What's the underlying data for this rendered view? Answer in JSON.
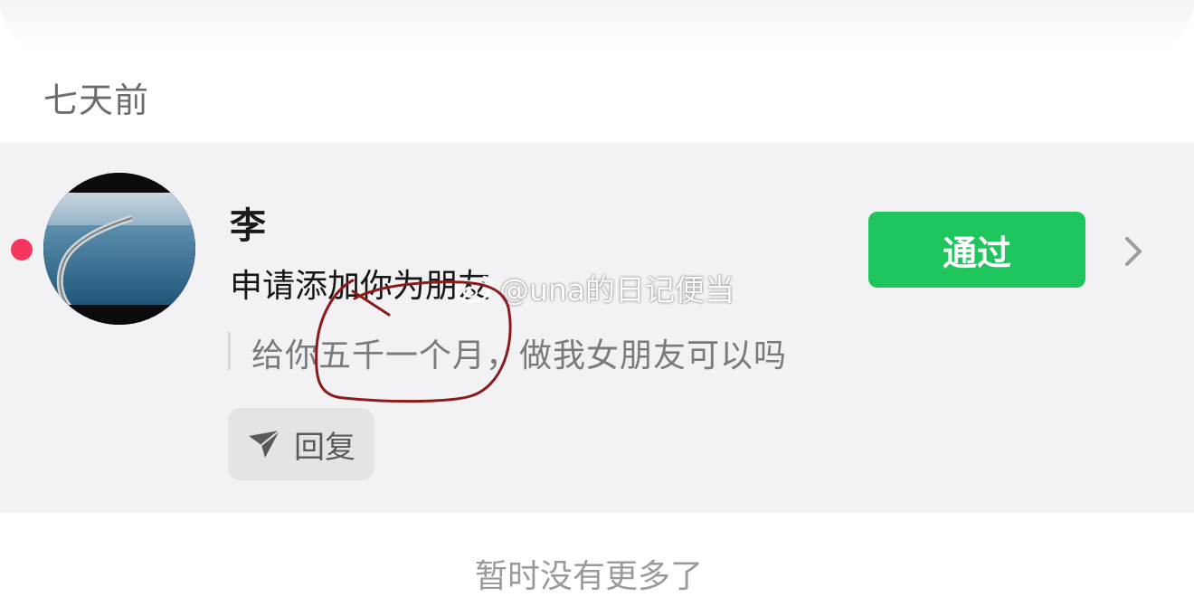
{
  "section": {
    "label": "七天前"
  },
  "request": {
    "name": "李",
    "request_text": "申请添加你为朋友",
    "message": "给你五千一个月，做我女朋友可以吗",
    "reply_label": "回复",
    "accept_label": "通过",
    "unread": true
  },
  "watermark": {
    "text": "@una的日记便当"
  },
  "footer": {
    "text": "暂时没有更多了"
  },
  "colors": {
    "accept_green": "#1ec45c",
    "unread_red": "#f5365c",
    "card_bg": "#f2f2f5",
    "annotation_ink": "#8b1a1a"
  },
  "icons": {
    "reply": "send-icon",
    "chevron": "chevron-right-icon",
    "watermark": "weibo-logo-icon"
  }
}
